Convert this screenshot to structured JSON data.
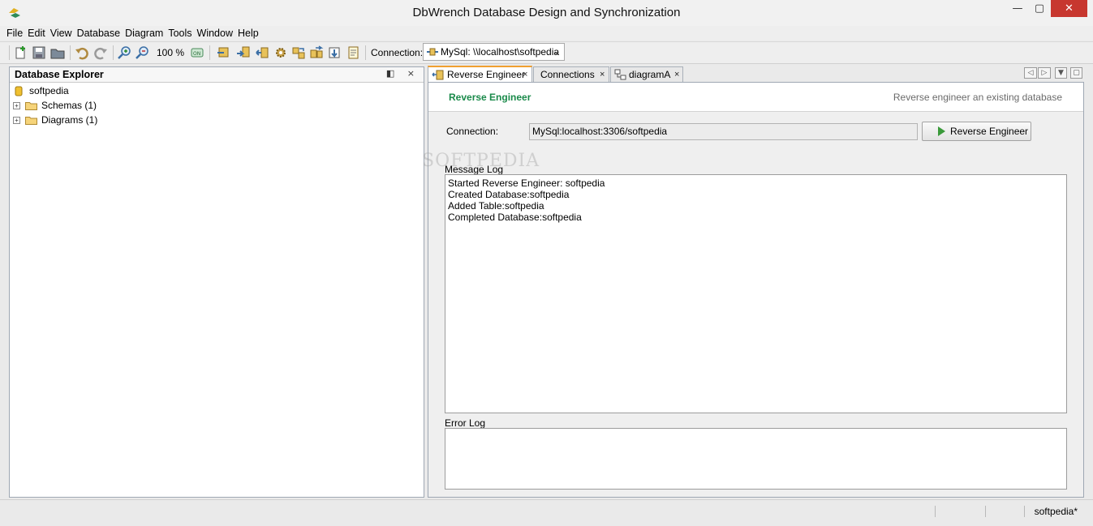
{
  "window": {
    "title": "DbWrench Database Design and Synchronization",
    "minimize": "—",
    "maximize": "▢",
    "close": "✕"
  },
  "menu": [
    "File",
    "Edit",
    "View",
    "Database",
    "Diagram",
    "Tools",
    "Window",
    "Help"
  ],
  "toolbar": {
    "zoom": "100 %",
    "connection_label": "Connection:",
    "connection_value": "MySql: \\\\localhost\\softpedia",
    "dropdown_arrow": "⌄"
  },
  "explorer": {
    "title": "Database Explorer",
    "header_icons": "◧ ×",
    "root": "softpedia",
    "expander": "+",
    "items": [
      {
        "label": "Schemas (1)"
      },
      {
        "label": "Diagrams (1)"
      }
    ]
  },
  "tabs": [
    {
      "label": "Reverse Engineer",
      "close": "×",
      "icon": "reverse-engineer-icon"
    },
    {
      "label": "Connections",
      "close": "×",
      "icon": ""
    },
    {
      "label": "diagramA",
      "close": "×",
      "icon": "diagram-icon"
    }
  ],
  "tab_controls": {
    "prev": "◁",
    "next": "▷",
    "menu": "▼",
    "max": "▢"
  },
  "editor": {
    "title": "Reverse Engineer",
    "description": "Reverse engineer an existing database",
    "connection_label": "Connection:",
    "connection_value": "MySql:localhost:3306/softpedia",
    "button_label": "Reverse Engineer",
    "message_log_label": "Message Log",
    "message_log": [
      "Started Reverse Engineer: softpedia",
      "Created Database:softpedia",
      "Added Table:softpedia",
      "Completed Database:softpedia"
    ],
    "error_log_label": "Error Log",
    "watermark": "SOFTPEDIA"
  },
  "status": {
    "text": "softpedia*"
  },
  "colors": {
    "accent_tab": "#f0a030",
    "editor_title": "#1a8a4a",
    "close_button": "#c7372f"
  }
}
